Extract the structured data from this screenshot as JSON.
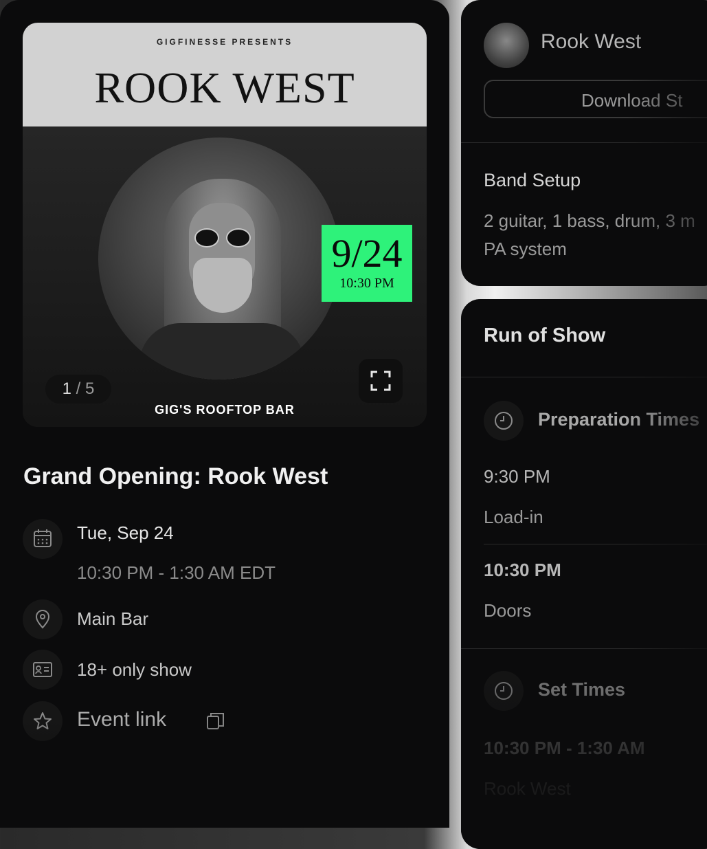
{
  "poster": {
    "presents": "GIGFINESSE PRESENTS",
    "title": "ROOK WEST",
    "date": "9/24",
    "time": "10:30 PM",
    "venue": "GIG'S ROOFTOP BAR",
    "counter_current": "1",
    "counter_sep": "/",
    "counter_total": "5"
  },
  "event": {
    "title": "Grand Opening: Rook West",
    "date": "Tue, Sep 24",
    "time_range": "10:30 PM - 1:30 AM EDT",
    "location": "Main Bar",
    "age": "18+ only show",
    "link_label": "Event link"
  },
  "artist": {
    "name": "Rook West",
    "download_label": "Download St"
  },
  "band_setup": {
    "title": "Band Setup",
    "line1": "2 guitar, 1 bass, drum, 3 m",
    "line2": "PA system"
  },
  "run_of_show": {
    "title": "Run of Show",
    "prep_title": "Preparation Times",
    "items": [
      {
        "time": "9:30 PM",
        "label": "Load-in"
      },
      {
        "time": "10:30 PM",
        "label": "Doors"
      }
    ],
    "set_title": "Set Times",
    "set_time": "10:30 PM - 1:30 AM",
    "set_artist": "Rook West"
  },
  "colors": {
    "accent_green": "#2ef27a",
    "panel_bg": "#0b0b0c"
  }
}
